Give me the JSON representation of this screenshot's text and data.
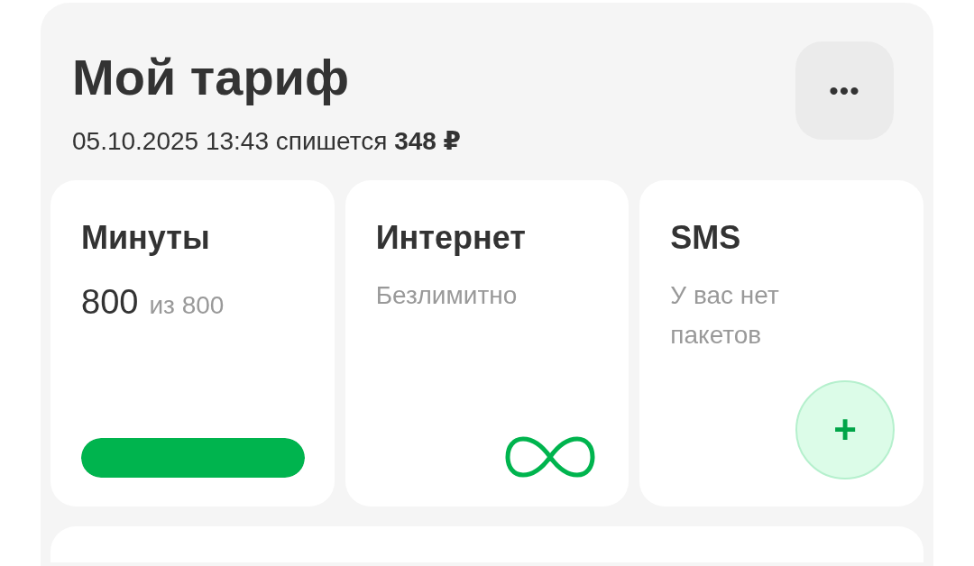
{
  "tariff": {
    "title": "Мой тариф",
    "subtitle": "05.10.2025 13:43 спишется **348 ₽**",
    "menu_button": "•••"
  },
  "cards": [
    {
      "kind": "progress",
      "title": "Минуты",
      "value": "800",
      "total": "из 800",
      "level": 1
    },
    {
      "kind": "unlimited",
      "title": "Интернет",
      "note": "Безлимитно"
    },
    {
      "kind": "empty",
      "title": "SMS",
      "note": "У вас нет пакетов",
      "add_button": "+"
    }
  ]
}
